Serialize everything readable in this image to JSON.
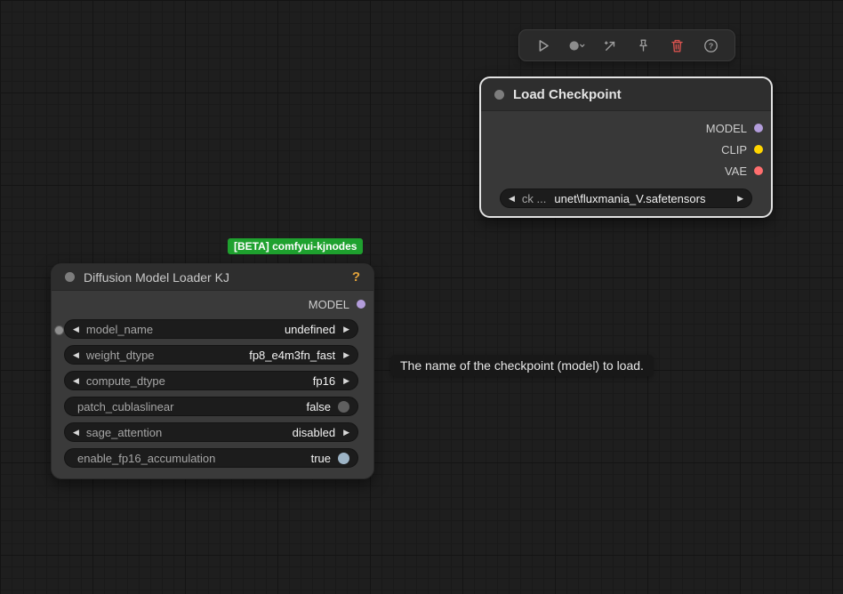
{
  "toolbar": {
    "buttons": [
      {
        "name": "run",
        "icon": "play-icon"
      },
      {
        "name": "color",
        "icon": "circle-dropdown-icon"
      },
      {
        "name": "convert",
        "icon": "cursor-arrow-icon"
      },
      {
        "name": "pin",
        "icon": "pin-icon"
      },
      {
        "name": "delete",
        "icon": "trash-icon"
      },
      {
        "name": "help",
        "icon": "help-icon"
      }
    ],
    "delete_color": "#d9534f",
    "icon_color": "#9c9c9c"
  },
  "chrome": {
    "combo_left": "◀",
    "combo_right": "▶"
  },
  "badge": {
    "label": "[BETA] comfyui-kjnodes"
  },
  "canvas": {
    "tooltip": "The name of the checkpoint (model) to load."
  },
  "nodes": {
    "load_checkpoint": {
      "title": "Load Checkpoint",
      "outputs": [
        {
          "label": "MODEL",
          "color": "#b39ddb"
        },
        {
          "label": "CLIP",
          "color": "#ffd500"
        },
        {
          "label": "VAE",
          "color": "#ff6e6e"
        }
      ],
      "widget": {
        "label": "ck ...",
        "value": "unet\\fluxmania_V.safetensors"
      }
    },
    "diffusion_loader": {
      "title": "Diffusion Model Loader KJ",
      "help_label": "?",
      "outputs": [
        {
          "label": "MODEL",
          "color": "#b39ddb"
        }
      ],
      "widgets": [
        {
          "type": "combo",
          "label": "model_name",
          "value": "undefined"
        },
        {
          "type": "combo",
          "label": "weight_dtype",
          "value": "fp8_e4m3fn_fast"
        },
        {
          "type": "combo",
          "label": "compute_dtype",
          "value": "fp16"
        },
        {
          "type": "toggle",
          "label": "patch_cublaslinear",
          "value": "false",
          "toggle_color": "#5f5f5f"
        },
        {
          "type": "combo",
          "label": "sage_attention",
          "value": "disabled"
        },
        {
          "type": "toggle",
          "label": "enable_fp16_accumulation",
          "value": "true",
          "toggle_color": "#9db4c6"
        }
      ]
    }
  }
}
